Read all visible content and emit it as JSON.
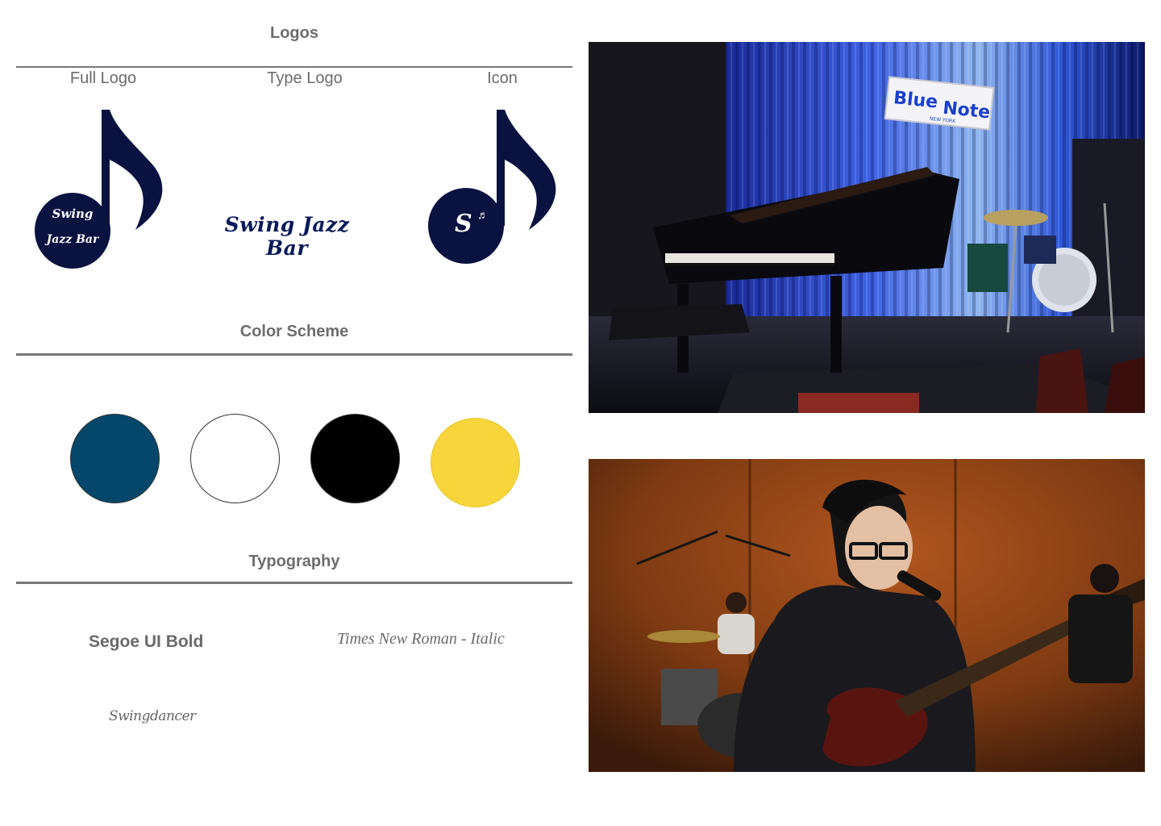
{
  "logos": {
    "title": "Logos",
    "labels": {
      "full": "Full Logo",
      "type": "Type Logo",
      "icon": "Icon"
    },
    "full_logo_line1": "Swing",
    "full_logo_line2": "Jazz Bar",
    "type_logo_text": "Swing Jazz Bar",
    "icon_letter": "S",
    "icon_note_glyph": "♬",
    "brand_color": "#0a1240"
  },
  "color_scheme": {
    "title": "Color Scheme",
    "swatches": [
      "#04476a",
      "#ffffff",
      "#000000",
      "#f8d53a"
    ]
  },
  "typography": {
    "title": "Typography",
    "font_bold": "Segoe UI Bold",
    "font_italic": "Times New Roman - Italic",
    "font_script": "Swingdancer"
  },
  "photos": {
    "stage_sign_word1": "Blue",
    "stage_sign_word2": "Note",
    "stage_sign_sub": "NEW YORK"
  }
}
